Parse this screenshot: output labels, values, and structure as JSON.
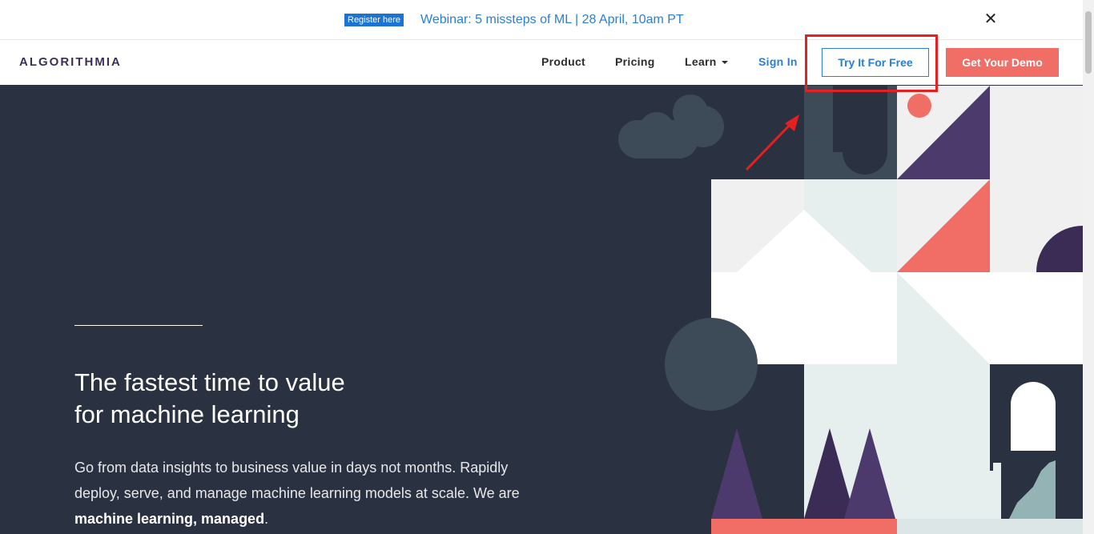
{
  "banner": {
    "badge": "Register here",
    "link": "Webinar: 5 missteps of ML | 28 April, 10am PT",
    "close": "✕"
  },
  "nav": {
    "logo": "ALGORITHMIA",
    "items": [
      "Product",
      "Pricing",
      "Learn"
    ],
    "signin": "Sign In",
    "try_free": "Try It For Free",
    "demo": "Get Your Demo"
  },
  "hero": {
    "title_line1": "The fastest time to value",
    "title_line2": "for machine learning",
    "body_text": "Go from data insights to business value in days not months. Rapidly deploy, serve, and manage machine learning models at scale. We are ",
    "body_bold": "machine learning, managed",
    "body_end": "."
  },
  "colors": {
    "hero_bg": "#2a3140",
    "accent_blue": "#2a7fd3",
    "coral": "#f06e66",
    "purple": "#4b3a6b",
    "dark_purple": "#3a2c55",
    "highlight_red": "#e62020"
  }
}
